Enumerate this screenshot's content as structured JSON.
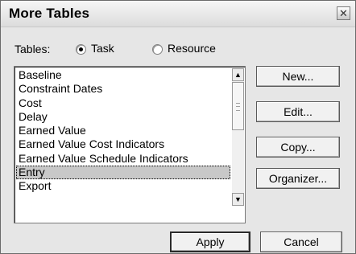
{
  "window": {
    "title": "More Tables",
    "close_glyph": "✕"
  },
  "tables": {
    "label": "Tables:",
    "options": [
      {
        "label": "Task",
        "checked": true
      },
      {
        "label": "Resource",
        "checked": false
      }
    ]
  },
  "list": {
    "items": [
      "Baseline",
      "Constraint Dates",
      "Cost",
      "Delay",
      "Earned Value",
      "Earned Value Cost Indicators",
      "Earned Value Schedule Indicators",
      "Entry",
      "Export"
    ],
    "selected": "Entry"
  },
  "side_buttons": {
    "new": "New...",
    "edit": "Edit...",
    "copy": "Copy...",
    "organizer": "Organizer..."
  },
  "footer_buttons": {
    "apply": "Apply",
    "cancel": "Cancel"
  },
  "scrollbar": {
    "up_glyph": "▲",
    "down_glyph": "▼"
  }
}
